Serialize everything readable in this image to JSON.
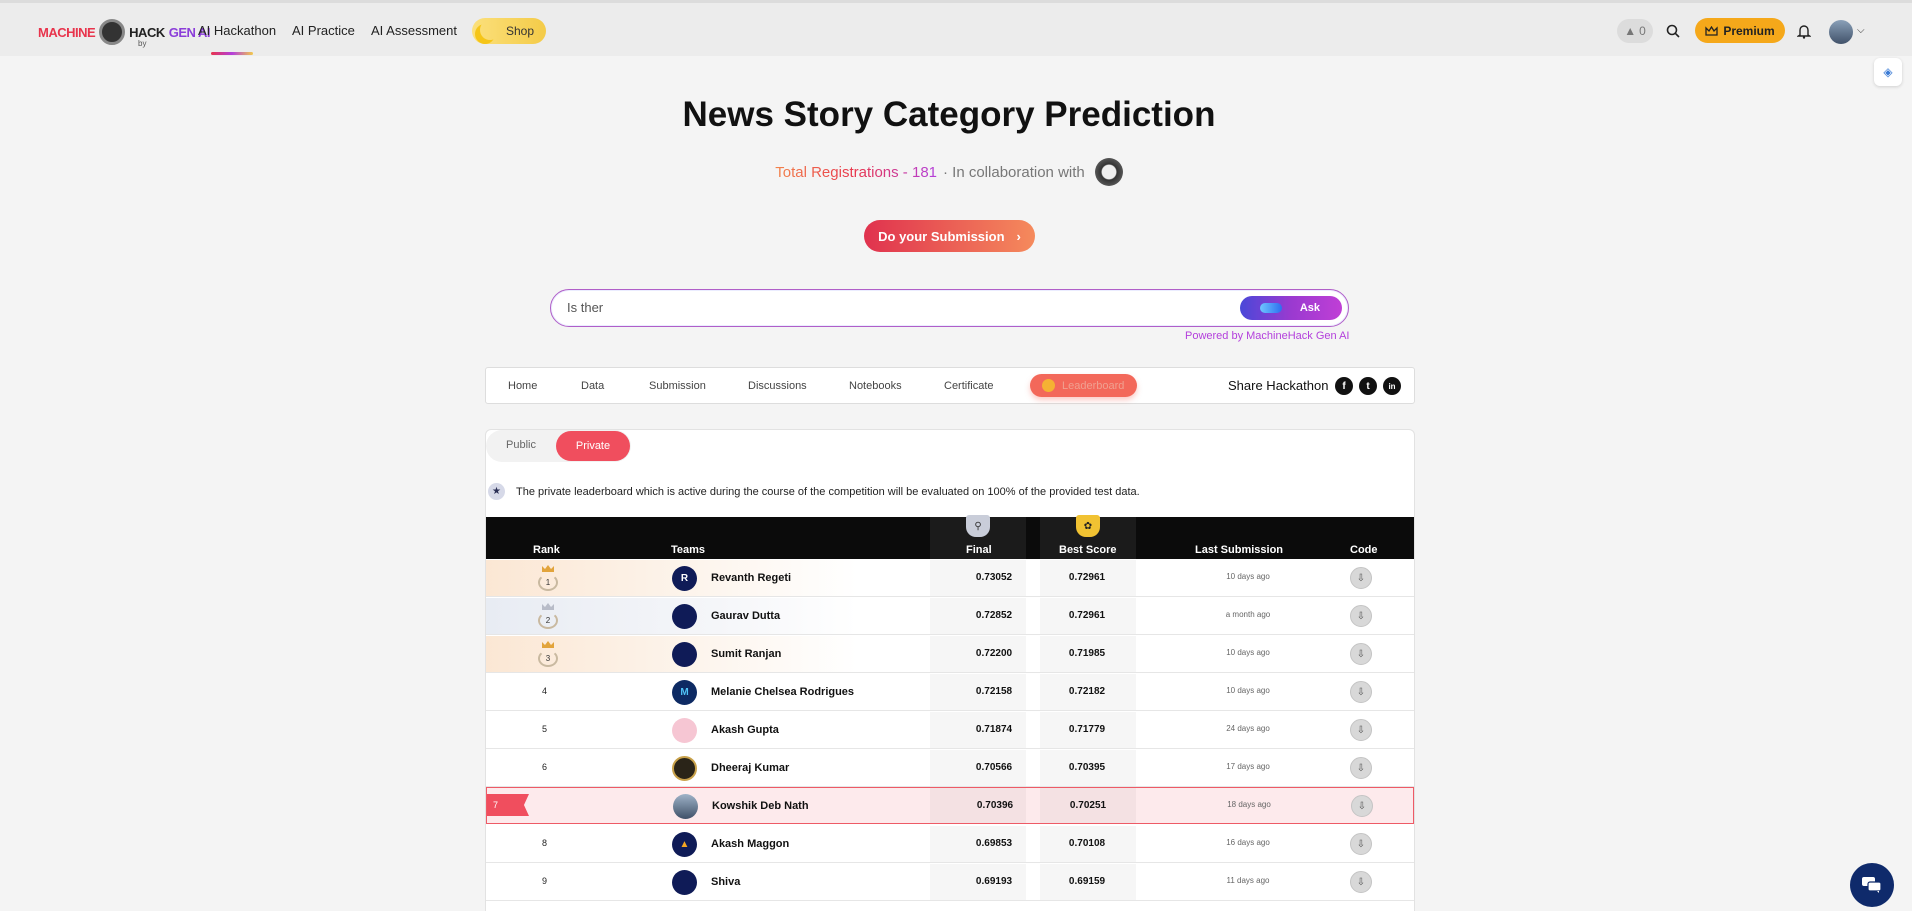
{
  "nav": {
    "logo_machine": "MACHINE",
    "logo_hack": "HACK",
    "logo_genai": "GEN AI",
    "logo_by": "by",
    "items": [
      "AI Hackathon",
      "AI Practice",
      "AI Assessment"
    ],
    "shop_label": "Shop",
    "streak_count": "0",
    "premium_label": "Premium"
  },
  "header": {
    "title": "News Story Category Prediction",
    "registrations_label": "Total Registrations - 181",
    "collab_label": "· In collaboration with"
  },
  "submit_label": "Do your Submission",
  "ask": {
    "input_value": "Is ther",
    "button_label": "Ask",
    "powered_by": "Powered by MachineHack Gen AI"
  },
  "tabs": {
    "items": [
      "Home",
      "Data",
      "Submission",
      "Discussions",
      "Notebooks",
      "Certificate"
    ],
    "active": "Leaderboard",
    "share_label": "Share Hackathon",
    "social": [
      "f",
      "t",
      "in"
    ]
  },
  "leaderboard": {
    "segments": [
      "Public",
      "Private"
    ],
    "active_segment": "Private",
    "note": "The private leaderboard which is active during the course of the competition will be evaluated on 100% of the provided test data.",
    "columns": [
      "Rank",
      "Teams",
      "Final",
      "Best Score",
      "Last Submission",
      "Code"
    ],
    "rows": [
      {
        "rank": "1",
        "team": "Revanth Regeti",
        "final": "0.73052",
        "best": "0.72961",
        "last": "10 days ago"
      },
      {
        "rank": "2",
        "team": "Gaurav Dutta",
        "final": "0.72852",
        "best": "0.72961",
        "last": "a month ago"
      },
      {
        "rank": "3",
        "team": "Sumit Ranjan",
        "final": "0.72200",
        "best": "0.71985",
        "last": "10 days ago"
      },
      {
        "rank": "4",
        "team": "Melanie Chelsea Rodrigues",
        "final": "0.72158",
        "best": "0.72182",
        "last": "10 days ago"
      },
      {
        "rank": "5",
        "team": "Akash Gupta",
        "final": "0.71874",
        "best": "0.71779",
        "last": "24 days ago"
      },
      {
        "rank": "6",
        "team": "Dheeraj Kumar",
        "final": "0.70566",
        "best": "0.70395",
        "last": "17 days ago"
      },
      {
        "rank": "7",
        "team": "Kowshik Deb Nath",
        "final": "0.70396",
        "best": "0.70251",
        "last": "18 days ago"
      },
      {
        "rank": "8",
        "team": "Akash Maggon",
        "final": "0.69853",
        "best": "0.70108",
        "last": "16 days ago"
      },
      {
        "rank": "9",
        "team": "Shiva",
        "final": "0.69193",
        "best": "0.69159",
        "last": "11 days ago"
      }
    ]
  },
  "colors": {
    "accent_red": "#f04e5e",
    "premium": "#f5a81a",
    "brand_purple": "#b33fdc"
  }
}
